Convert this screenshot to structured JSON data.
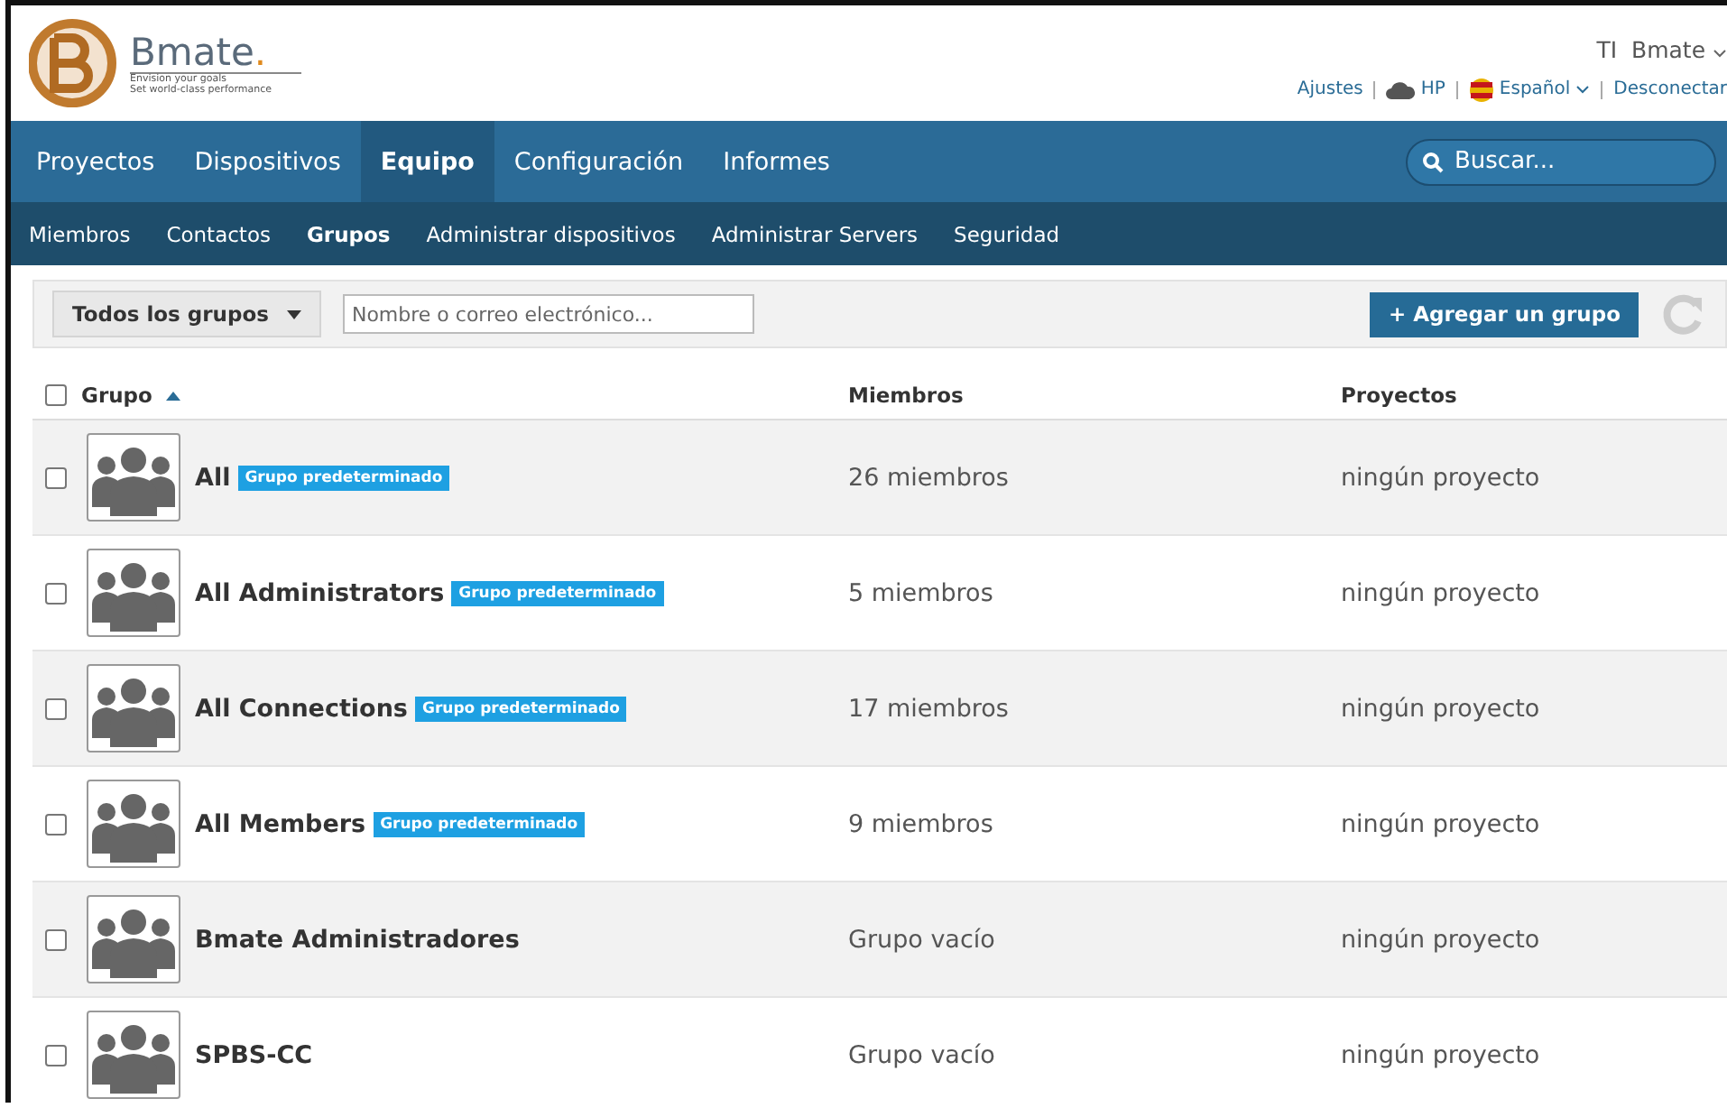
{
  "logo": {
    "brand": "Bmate",
    "dot": ".",
    "tagline": [
      "Envision your goals",
      "Set world-class performance"
    ]
  },
  "user": {
    "initials": "TI",
    "name": "Bmate"
  },
  "header_links": [
    {
      "kind": "text",
      "label": "Ajustes"
    },
    {
      "kind": "cloud",
      "label": "HP"
    },
    {
      "kind": "flag",
      "label": "Español"
    },
    {
      "kind": "text",
      "label": "Desconectar"
    }
  ],
  "nav": [
    {
      "label": "Proyectos",
      "selected": false
    },
    {
      "label": "Dispositivos",
      "selected": false
    },
    {
      "label": "Equipo",
      "selected": true
    },
    {
      "label": "Configuración",
      "selected": false
    },
    {
      "label": "Informes",
      "selected": false
    }
  ],
  "search": {
    "placeholder": "Buscar..."
  },
  "subnav": [
    {
      "label": "Miembros",
      "selected": false
    },
    {
      "label": "Contactos",
      "selected": false
    },
    {
      "label": "Grupos",
      "selected": true
    },
    {
      "label": "Administrar dispositivos",
      "selected": false
    },
    {
      "label": "Administrar Servers",
      "selected": false
    },
    {
      "label": "Seguridad",
      "selected": false
    }
  ],
  "toolbar": {
    "filter": "Todos los grupos",
    "field_placeholder": "Nombre o correo electrónico...",
    "add_button": "+ Agregar un grupo"
  },
  "table": {
    "columns": [
      "Grupo",
      "Miembros",
      "Proyectos"
    ],
    "select_all": false,
    "rows": [
      {
        "name": "All",
        "badge": "Grupo predeterminado",
        "members": "26 miembros",
        "projects": "ningún proyecto",
        "checked": false
      },
      {
        "name": "All Administrators",
        "badge": "Grupo predeterminado",
        "members": "5 miembros",
        "projects": "ningún proyecto",
        "checked": false
      },
      {
        "name": "All Connections",
        "badge": "Grupo predeterminado",
        "members": "17 miembros",
        "projects": "ningún proyecto",
        "checked": false
      },
      {
        "name": "All Members",
        "badge": "Grupo predeterminado",
        "members": "9 miembros",
        "projects": "ningún proyecto",
        "checked": false
      },
      {
        "name": "Bmate Administradores",
        "members": "Grupo vacío",
        "projects": "ningún proyecto",
        "checked": false
      },
      {
        "name": "SPBS-CC",
        "members": "Grupo vacío",
        "projects": "ningún proyecto",
        "checked": false
      }
    ]
  }
}
